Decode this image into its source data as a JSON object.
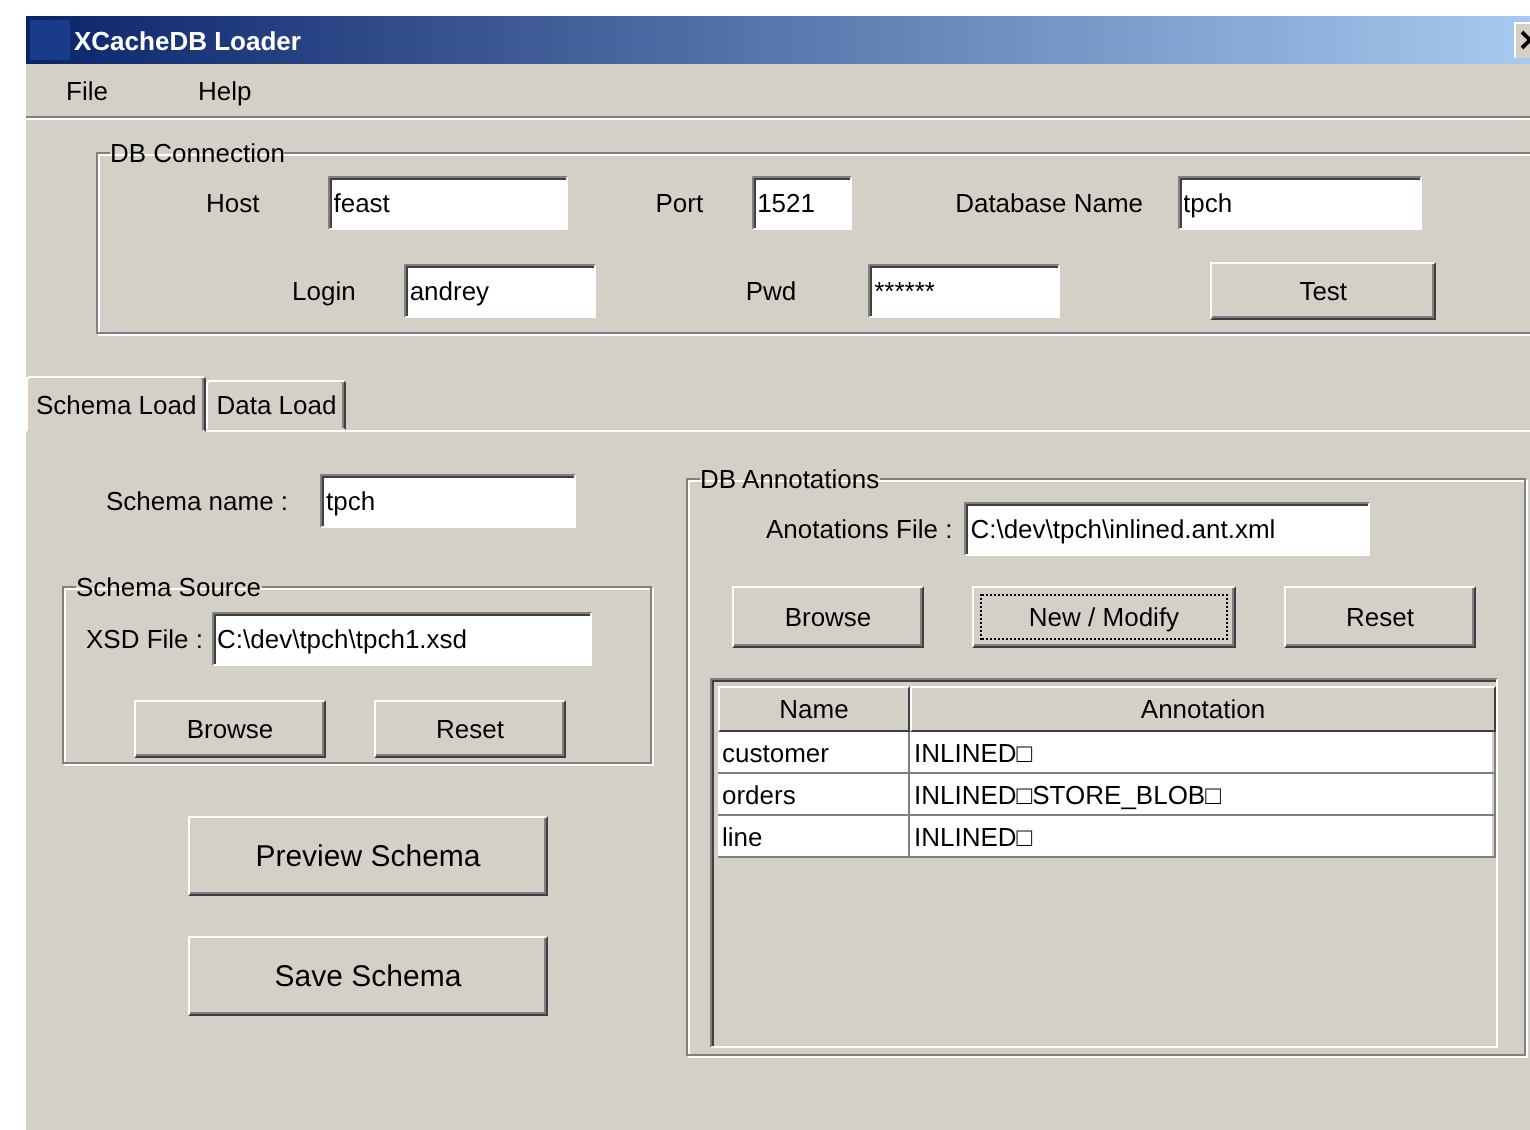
{
  "window": {
    "title": "XCacheDB Loader"
  },
  "menu": [
    {
      "label": "File"
    },
    {
      "label": "Help"
    }
  ],
  "db_connection": {
    "title": "DB Connection",
    "host": {
      "label": "Host",
      "value": "feast"
    },
    "port": {
      "label": "Port",
      "value": "1521"
    },
    "database_name": {
      "label": "Database Name",
      "value": "tpch"
    },
    "login": {
      "label": "Login",
      "value": "andrey"
    },
    "pwd": {
      "label": "Pwd",
      "value": "******"
    },
    "test_button": "Test"
  },
  "tabs": [
    {
      "label": "Schema Load",
      "selected": true
    },
    {
      "label": "Data Load",
      "selected": false
    }
  ],
  "schema_load": {
    "schema_name": {
      "label": "Schema name :",
      "value": "tpch"
    },
    "schema_source": {
      "title": "Schema Source",
      "xsd_file": {
        "label": "XSD File :",
        "value": "C:\\dev\\tpch\\tpch1.xsd"
      },
      "buttons": [
        "Browse",
        "Reset"
      ]
    },
    "buttons": [
      "Preview Schema",
      "Save Schema"
    ]
  },
  "db_annotations": {
    "title": "DB Annotations",
    "annotations_file": {
      "label": "Anotations File :",
      "value": "C:\\dev\\tpch\\inlined.ant.xml"
    },
    "buttons": [
      {
        "label": "Browse",
        "focused": false
      },
      {
        "label": "New / Modify",
        "focused": true
      },
      {
        "label": "Reset",
        "focused": false
      }
    ],
    "table": {
      "columns": [
        "Name",
        "Annotation"
      ],
      "rows": [
        [
          "customer",
          "INLINED□"
        ],
        [
          "orders",
          "INLINED□STORE_BLOB□"
        ],
        [
          "line",
          "INLINED□"
        ]
      ]
    }
  }
}
